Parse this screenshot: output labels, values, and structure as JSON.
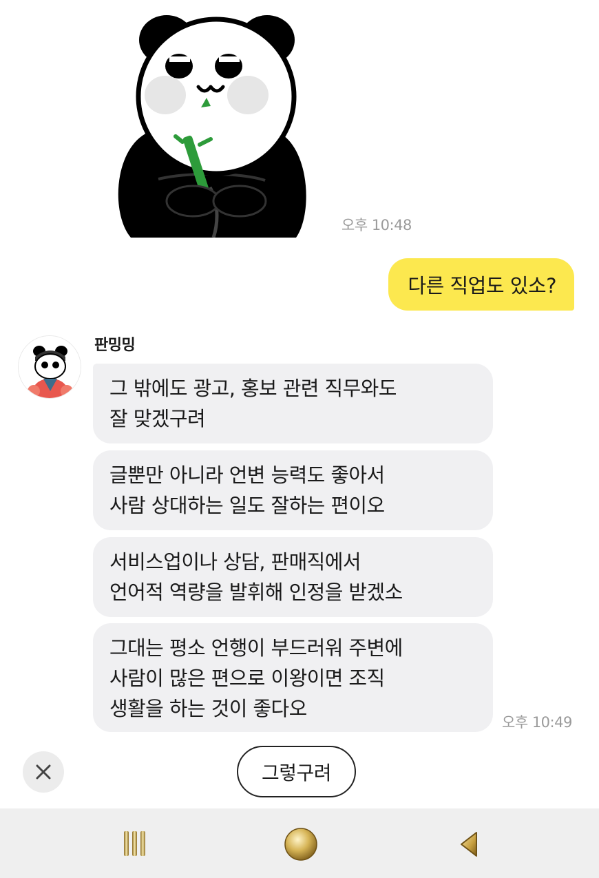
{
  "messages": {
    "sticker_time": "오후 10:48",
    "my_message": "다른 직업도 있소?",
    "sender_name": "판밍밍",
    "replies": [
      "그 밖에도 광고, 홍보 관련 직무와도\n잘 맞겠구려",
      "글뿐만 아니라 언변 능력도 좋아서\n사람 상대하는 일도 잘하는 편이오",
      "서비스업이나 상담, 판매직에서\n언어적 역량을 발휘해 인정을 받겠소",
      "그대는 평소 언행이 부드러워 주변에\n사람이 많은 편으로 이왕이면 조직\n생활을 하는 것이 좋다오"
    ],
    "reply_time": "오후 10:49"
  },
  "quick_reply": {
    "label": "그렇구려",
    "close_icon": "close-icon"
  },
  "navbar": {
    "recent_icon": "recent-apps-icon",
    "home_icon": "home-icon",
    "back_icon": "back-icon"
  },
  "colors": {
    "my_bubble": "#fce84f",
    "other_bubble": "#f0f0f2",
    "navbar_bg": "#efefef",
    "nav_gold": "#c9a648"
  }
}
